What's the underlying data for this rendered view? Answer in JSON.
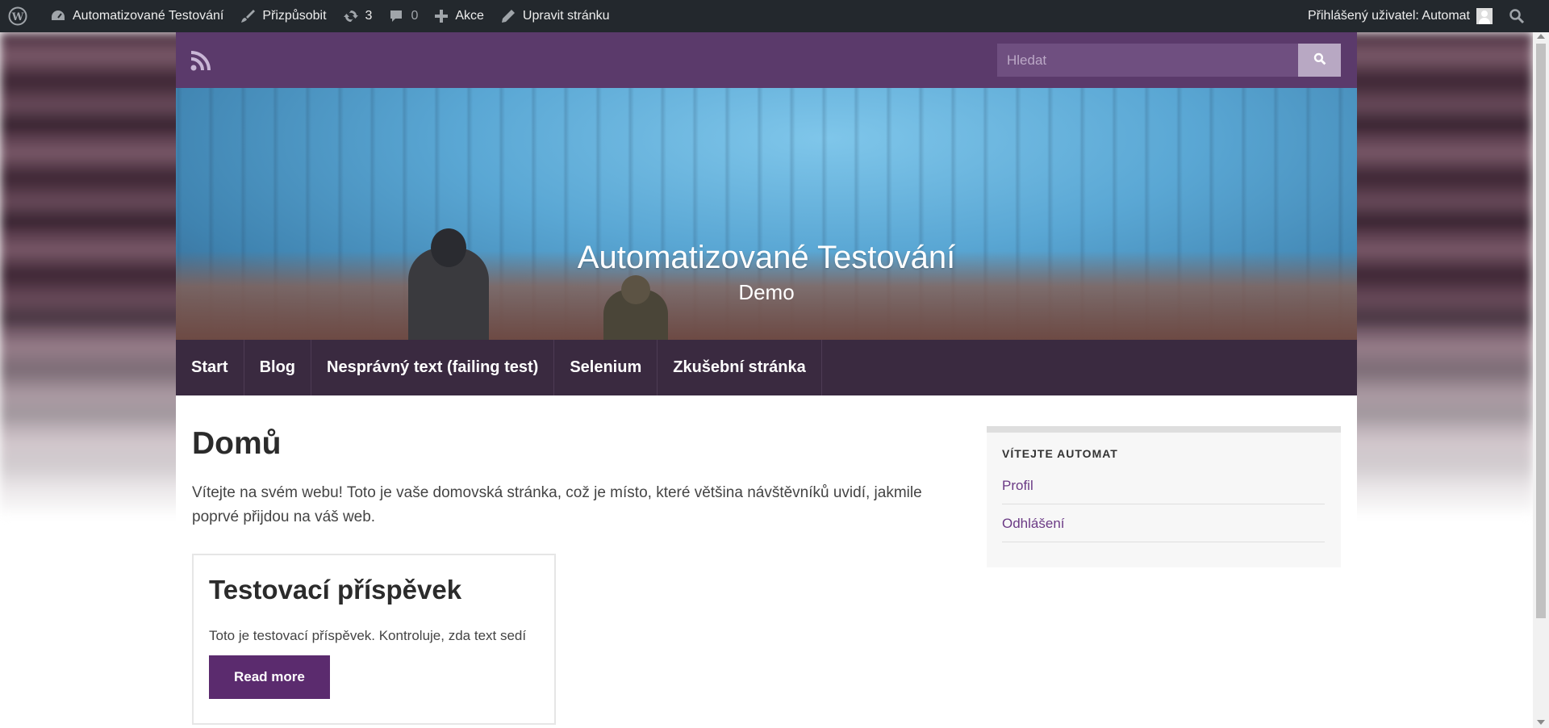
{
  "admin_bar": {
    "site_name": "Automatizované Testování",
    "customize": "Přizpůsobit",
    "updates_count": "3",
    "comments_count": "0",
    "new": "Akce",
    "edit_page": "Upravit stránku",
    "logged_in_user": "Přihlášený uživatel: Automat"
  },
  "header": {
    "search_placeholder": "Hledat",
    "site_title": "Automatizované Testování",
    "site_description": "Demo"
  },
  "nav": {
    "items": [
      {
        "label": "Start"
      },
      {
        "label": "Blog"
      },
      {
        "label": "Nesprávný text (failing test)"
      },
      {
        "label": "Selenium"
      },
      {
        "label": "Zkušební stránka"
      }
    ]
  },
  "main": {
    "title": "Domů",
    "intro": "Vítejte na svém webu! Toto je vaše domovská stránka, což je místo, které většina návštěvníků uvidí, jakmile poprvé přijdou na váš web.",
    "post": {
      "title": "Testovací příspěvek",
      "excerpt": "Toto je testovací příspěvek. Kontroluje, zda text sedí",
      "button": "Read more"
    }
  },
  "sidebar": {
    "widget_title": "VÍTEJTE AUTOMAT",
    "links": [
      {
        "label": "Profil"
      },
      {
        "label": "Odhlášení"
      }
    ]
  },
  "colors": {
    "admin_bar": "#23282d",
    "topbar": "#5b3a6b",
    "nav": "#3a2a40",
    "accent": "#5b2b6e",
    "link": "#6b3a85"
  }
}
